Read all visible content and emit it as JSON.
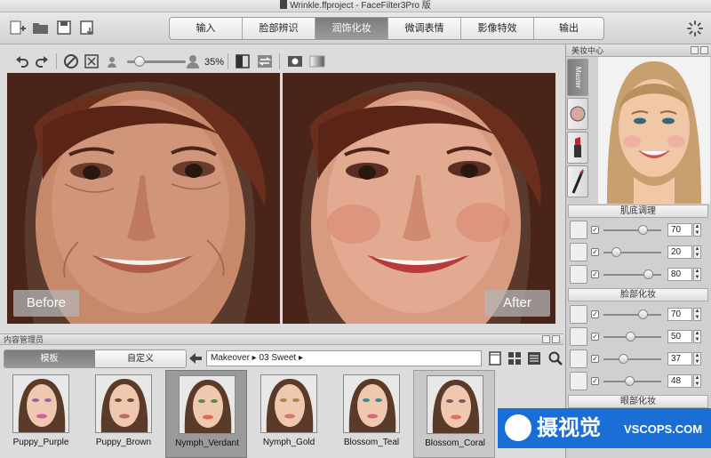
{
  "window": {
    "title": "Wrinkle.ffproject - FaceFilter3Pro 版"
  },
  "toolbar": {
    "tabs": [
      {
        "label": "输入",
        "active": false
      },
      {
        "label": "脸部辨识",
        "active": false
      },
      {
        "label": "润饰化妆",
        "active": true
      },
      {
        "label": "微调表情",
        "active": false
      },
      {
        "label": "影像特效",
        "active": false
      },
      {
        "label": "输出",
        "active": false
      }
    ]
  },
  "edit": {
    "zoom_pct": "35%"
  },
  "photos": {
    "before_label": "Before",
    "after_label": "After"
  },
  "right_panel": {
    "title": "美妆中心",
    "master_tab": "Master",
    "sections": [
      {
        "title": "肌底调理",
        "rows": [
          {
            "value": "70",
            "pct": 0.78
          },
          {
            "value": "20",
            "pct": 0.25
          },
          {
            "value": "80",
            "pct": 0.86
          }
        ]
      },
      {
        "title": "脸部化妆",
        "rows": [
          {
            "value": "70",
            "pct": 0.78
          },
          {
            "value": "50",
            "pct": 0.55
          },
          {
            "value": "37",
            "pct": 0.42
          },
          {
            "value": "48",
            "pct": 0.52
          }
        ]
      },
      {
        "title": "眼部化妆"
      }
    ]
  },
  "content_manager": {
    "title": "内容管理员",
    "tabs": [
      {
        "label": "模板",
        "active": true
      },
      {
        "label": "自定义",
        "active": false
      }
    ],
    "path": "Makeover ▸ 03 Sweet ▸",
    "thumbnails": [
      {
        "name": "Puppy_Purple",
        "lip": "#d65a9c",
        "eye": "#8a6a9a"
      },
      {
        "name": "Puppy_Brown",
        "lip": "#c06a68",
        "eye": "#6a4a3a"
      },
      {
        "name": "Nymph_Verdant",
        "lip": "#e06a4a",
        "eye": "#5a8a4a",
        "selected": true
      },
      {
        "name": "Nymph_Gold",
        "lip": "#d07a6a",
        "eye": "#a08a4a"
      },
      {
        "name": "Blossom_Teal",
        "lip": "#d06a80",
        "eye": "#3a8a8a"
      },
      {
        "name": "Blossom_Coral",
        "lip": "#e07060",
        "eye": "#7a5a5a",
        "highlight": true
      }
    ]
  },
  "watermark": {
    "cn": "摄视觉",
    "en": "VSCOPS.COM"
  }
}
